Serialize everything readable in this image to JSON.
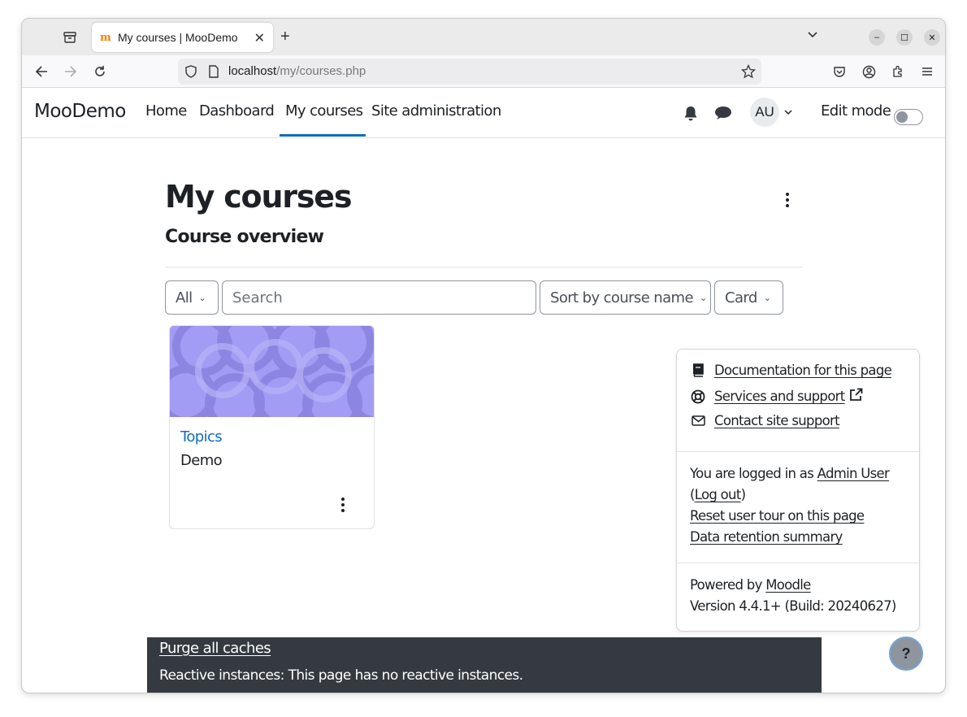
{
  "browser": {
    "tab_title": "My courses | MooDemo",
    "url_host": "localhost",
    "url_path": "/my/courses.php"
  },
  "nav": {
    "brand": "MooDemo",
    "links": [
      "Home",
      "Dashboard",
      "My courses",
      "Site administration"
    ],
    "avatar_initials": "AU",
    "edit_mode_label": "Edit mode"
  },
  "main": {
    "page_title": "My courses",
    "section_title": "Course overview",
    "filter_value": "All",
    "search_placeholder": "Search",
    "sort_value": "Sort by course name",
    "view_value": "Card",
    "courses": [
      {
        "category": "Topics",
        "name": "Demo"
      }
    ]
  },
  "footer_popover": {
    "documentation": "Documentation for this page",
    "services": "Services and support",
    "contact": "Contact site support",
    "logged_in_prefix": "You are logged in as ",
    "user_name": "Admin User",
    "logout_open": "(",
    "logout": "Log out",
    "logout_close": ")",
    "reset_tour": "Reset user tour on this page",
    "data_retention": "Data retention summary",
    "powered_prefix": "Powered by ",
    "moodle": "Moodle",
    "version": "Version 4.4.1+ (Build: 20240627)"
  },
  "dev": {
    "purge": "Purge all caches",
    "reactive": "Reactive instances: This page has no reactive instances."
  },
  "help_button": "?",
  "colors": {
    "accent": "#0f6cbf",
    "dev_bar": "#343a40",
    "card_image": "#a39cf5"
  }
}
